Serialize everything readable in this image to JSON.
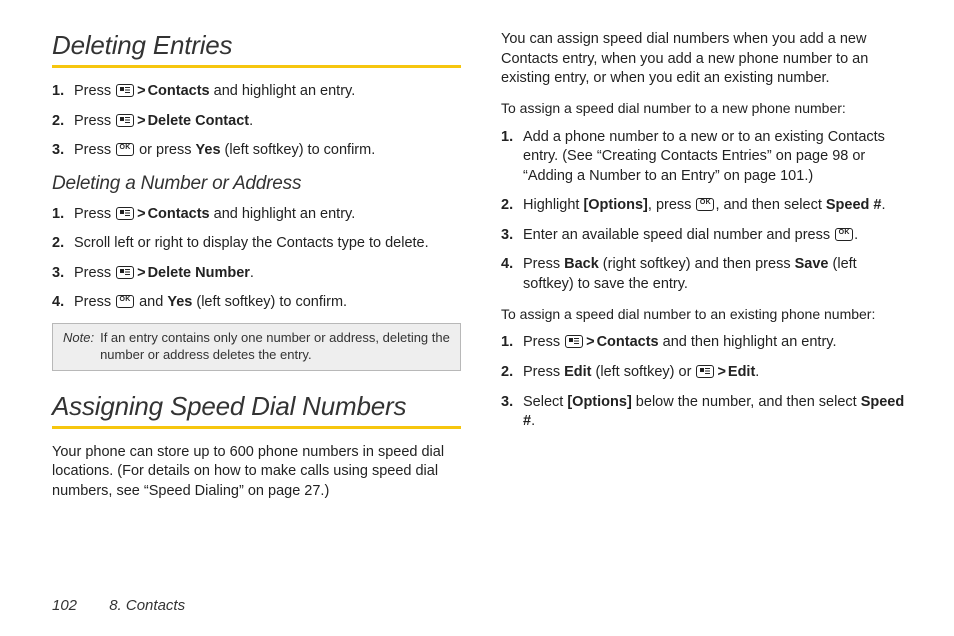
{
  "left": {
    "h2a": "Deleting Entries",
    "del_steps": [
      {
        "pre": "Press ",
        "icon1": "menu",
        "gt": ">",
        "b1": "Contacts",
        "post": " and highlight an entry."
      },
      {
        "pre": "Press ",
        "icon1": "menu",
        "gt": ">",
        "b1": "Delete Contact",
        "post": "."
      },
      {
        "pre": "Press ",
        "icon1": "ok",
        "mid": " or press ",
        "b1": "Yes",
        "post": " (left softkey) to confirm."
      }
    ],
    "h3a": "Deleting a Number or Address",
    "delnum_steps": [
      {
        "pre": "Press ",
        "icon1": "menu",
        "gt": ">",
        "b1": "Contacts",
        "post": " and highlight an entry."
      },
      {
        "plain": "Scroll left or right to display the Contacts type to delete."
      },
      {
        "pre": "Press ",
        "icon1": "menu",
        "gt": ">",
        "b1": "Delete Number",
        "post": "."
      },
      {
        "pre": "Press ",
        "icon1": "ok",
        "mid": " and ",
        "b1": "Yes",
        "post": " (left softkey) to confirm."
      }
    ],
    "note_label": "Note:",
    "note_text": "If an entry contains only one number or address, deleting the number or address deletes the entry.",
    "h2b": "Assigning Speed Dial Numbers",
    "para1": "Your phone can store up to 600 phone numbers in speed dial locations. (For details on how to make calls using speed dial numbers, see “Speed Dialing” on page 27.)"
  },
  "right": {
    "para1": "You can assign speed dial numbers when you add a new Contacts entry, when you add a new phone number to an existing entry, or when you edit an existing number.",
    "lead1": "To assign a speed dial number to a new phone number:",
    "new_steps": [
      {
        "plain": "Add a phone number to a new or to an existing Contacts entry. (See “Creating Contacts Entries” on page 98 or “Adding a Number to an Entry” on page 101.)"
      },
      {
        "pre": "Highlight ",
        "b1": "[Options]",
        "mid1": ", press ",
        "icon1": "ok",
        "mid2": ", and then select ",
        "b2": "Speed #",
        "post": "."
      },
      {
        "pre": "Enter an available speed dial number and press ",
        "icon1": "ok",
        "post": "."
      },
      {
        "pre": "Press ",
        "b1": "Back",
        "mid1": " (right softkey) and then press ",
        "b2": "Save",
        "post": " (left softkey) to save the entry."
      }
    ],
    "lead2": "To assign a speed dial number to an existing phone number:",
    "exist_steps": [
      {
        "pre": "Press ",
        "icon1": "menu",
        "gt": ">",
        "b1": "Contacts",
        "post": " and then highlight an entry."
      },
      {
        "pre": "Press ",
        "b1": "Edit",
        "mid1": " (left softkey) or ",
        "icon1": "menu",
        "gt": ">",
        "b2": "Edit",
        "post": "."
      },
      {
        "pre": "Select ",
        "b1": "[Options]",
        "mid1": " below the number, and then select ",
        "b2": "Speed #",
        "post": "."
      }
    ]
  },
  "footer": {
    "page": "102",
    "chapter": "8. Contacts"
  }
}
